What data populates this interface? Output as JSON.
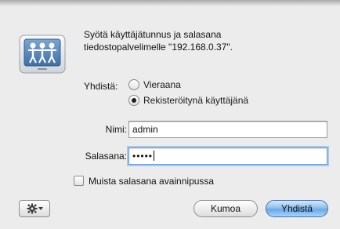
{
  "dialog": {
    "message_line1": "Syötä käyttäjätunnus ja salasana",
    "message_line2": "tiedostopalvelimelle \"192.168.0.37\".",
    "connect_label": "Yhdistä:",
    "options": [
      {
        "label": "Vieraana",
        "selected": false
      },
      {
        "label": "Rekisteröitynä käyttäjänä",
        "selected": true
      }
    ],
    "name_label": "Nimi:",
    "name_value": "admin",
    "password_label": "Salasana:",
    "password_masked": "•••••",
    "remember_label": "Muista salasana avainnipussa",
    "remember_checked": false,
    "cancel_label": "Kumoa",
    "connect_button_label": "Yhdistä",
    "action_icon": "gear-icon"
  },
  "colors": {
    "window_bg": "#ececec",
    "focus_ring": "#a9c7ec",
    "default_button": "#6aa8e6"
  }
}
